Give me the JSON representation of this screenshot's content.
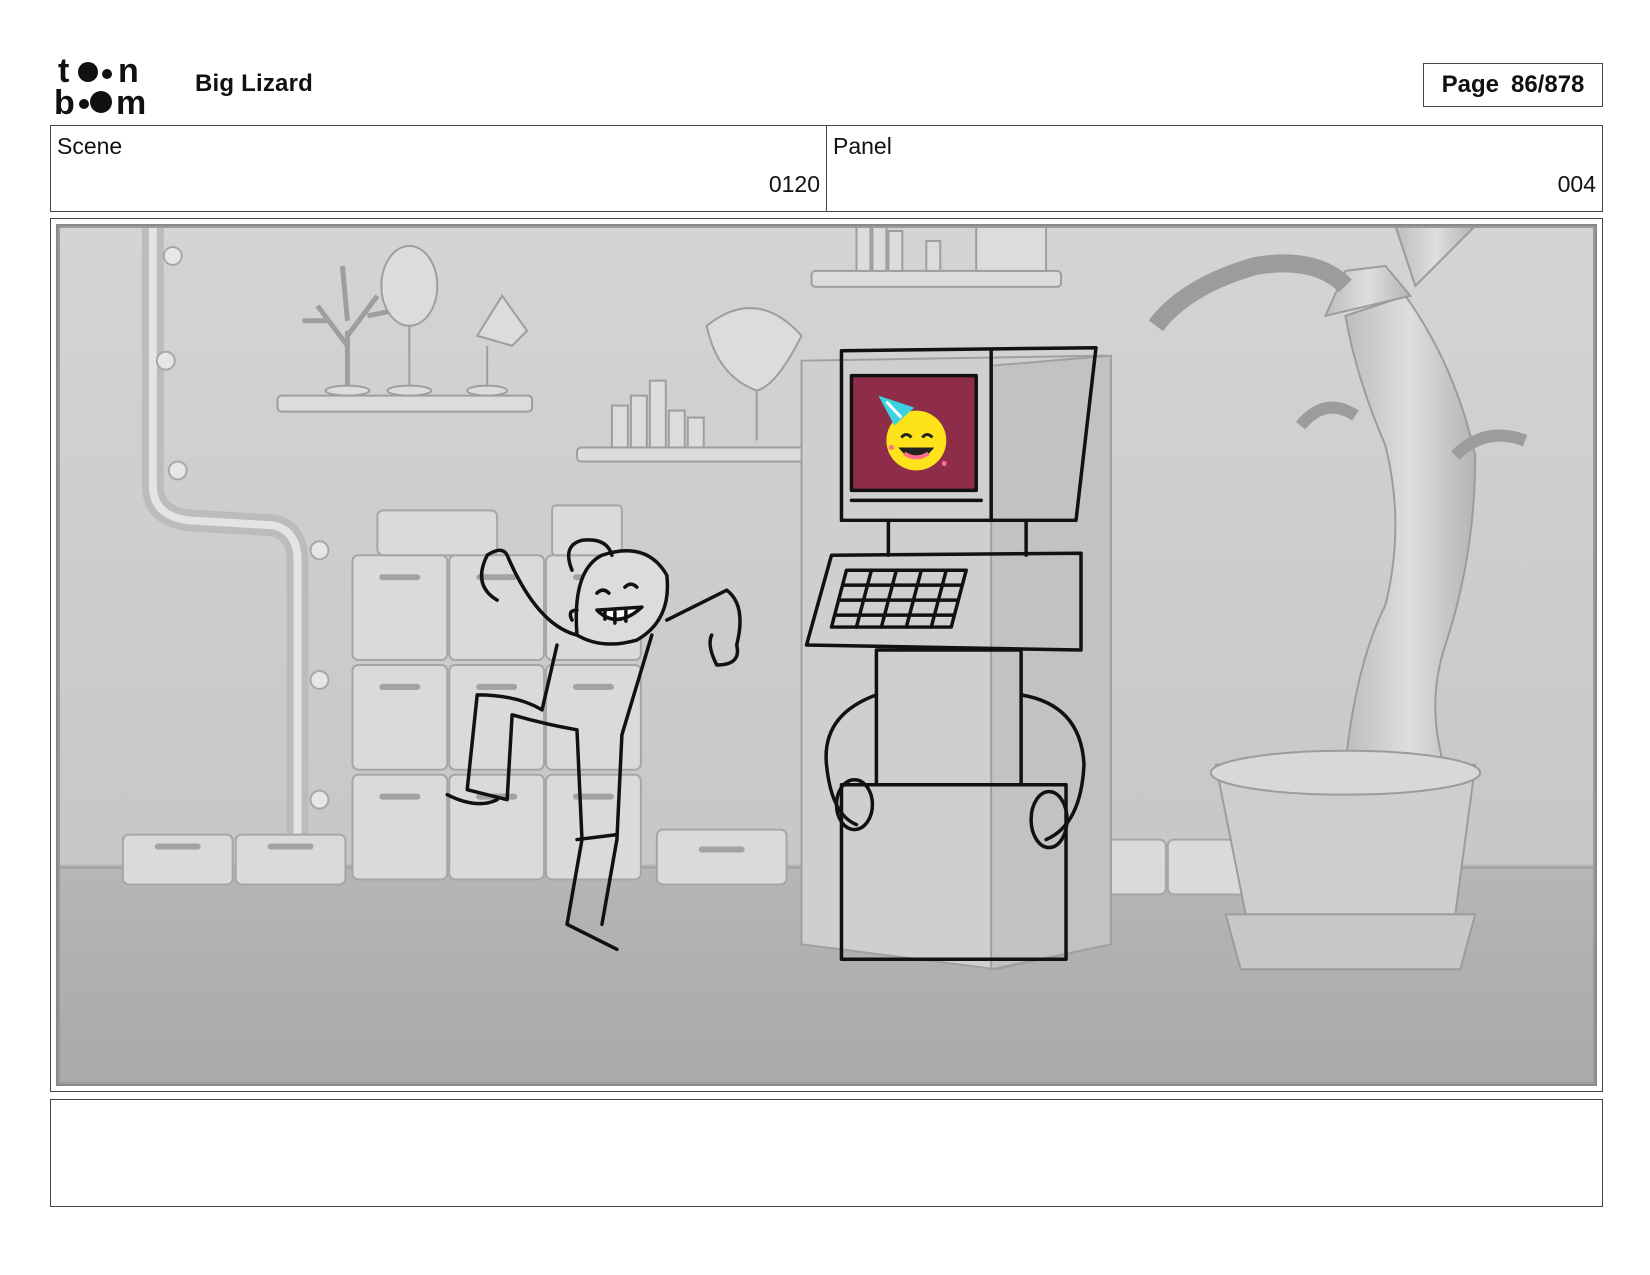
{
  "header": {
    "logo_text": "toon boom",
    "project_title": "Big Lizard",
    "page_label": "Page",
    "page_number": "86/878"
  },
  "info": {
    "scene_label": "Scene",
    "scene_value": "0120",
    "panel_label": "Panel",
    "panel_value": "004"
  },
  "panel": {
    "description": "",
    "screen_color": "#8e2d49",
    "emoji_color": "#ffe31a"
  },
  "notes": {
    "text": ""
  }
}
